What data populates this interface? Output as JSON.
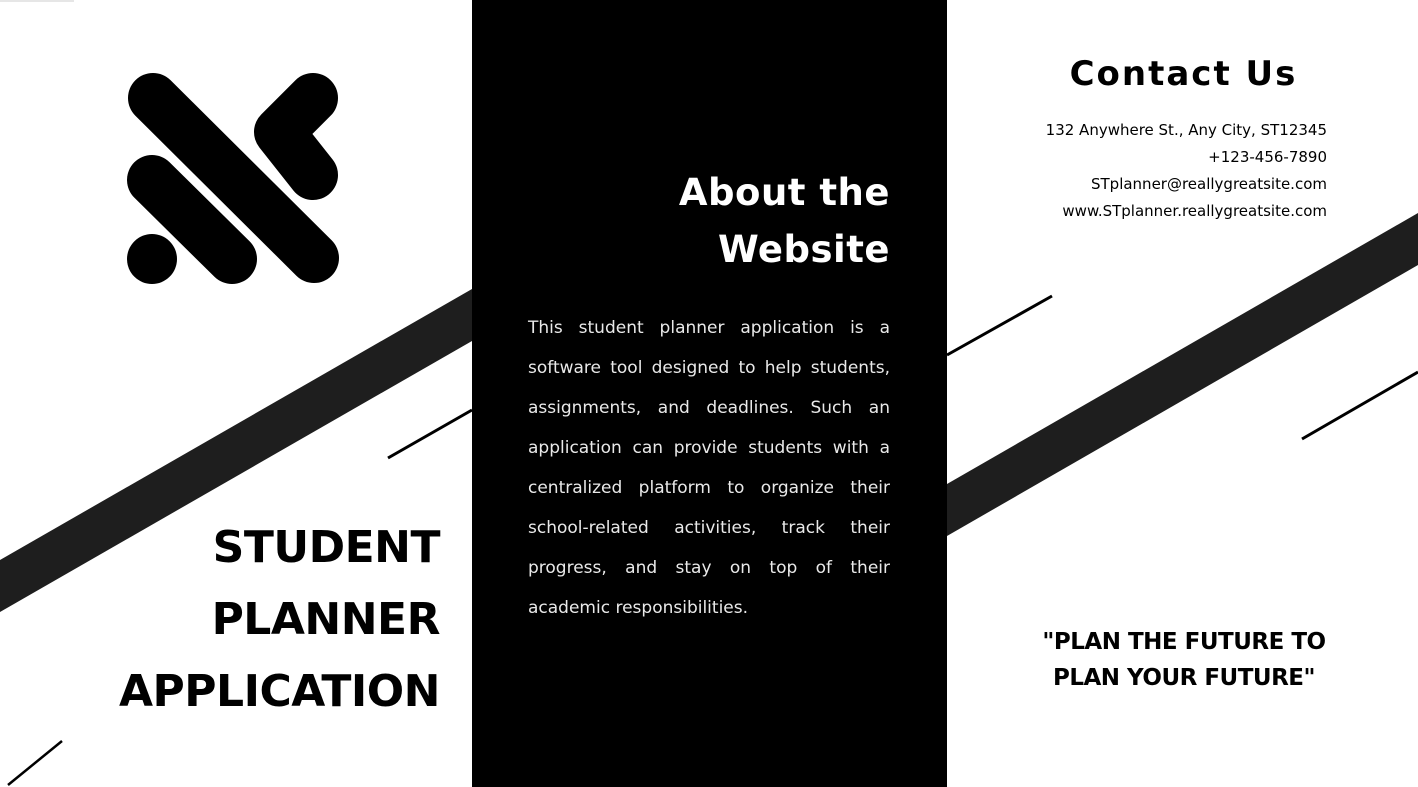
{
  "brochure": {
    "title_lines": [
      "STUDENT",
      "PLANNER",
      "APPLICATION"
    ],
    "about": {
      "heading_lines": [
        "About the",
        "Website"
      ],
      "body": "This student planner application is a software tool designed to help students, assignments, and deadlines. Such an application can provide students with a centralized platform to organize their school-related activities, track their progress, and stay on top of their academic responsibilities."
    },
    "contact": {
      "heading": "Contact Us",
      "address": "132 Anywhere St., Any City, ST12345",
      "phone": "+123-456-7890",
      "email": "STplanner@reallygreatsite.com",
      "website": "www.STplanner.reallygreatsite.com"
    },
    "slogan_lines": [
      "\"PLAN THE FUTURE TO",
      "PLAN YOUR FUTURE\""
    ]
  },
  "colors": {
    "background": "#ffffff",
    "dark_panel": "#000000",
    "stripe": "#1e1e1e",
    "text_dark": "#000000",
    "text_light": "#ffffff"
  },
  "icons": {
    "logo": "abstract-diagonal-bars-logo"
  }
}
